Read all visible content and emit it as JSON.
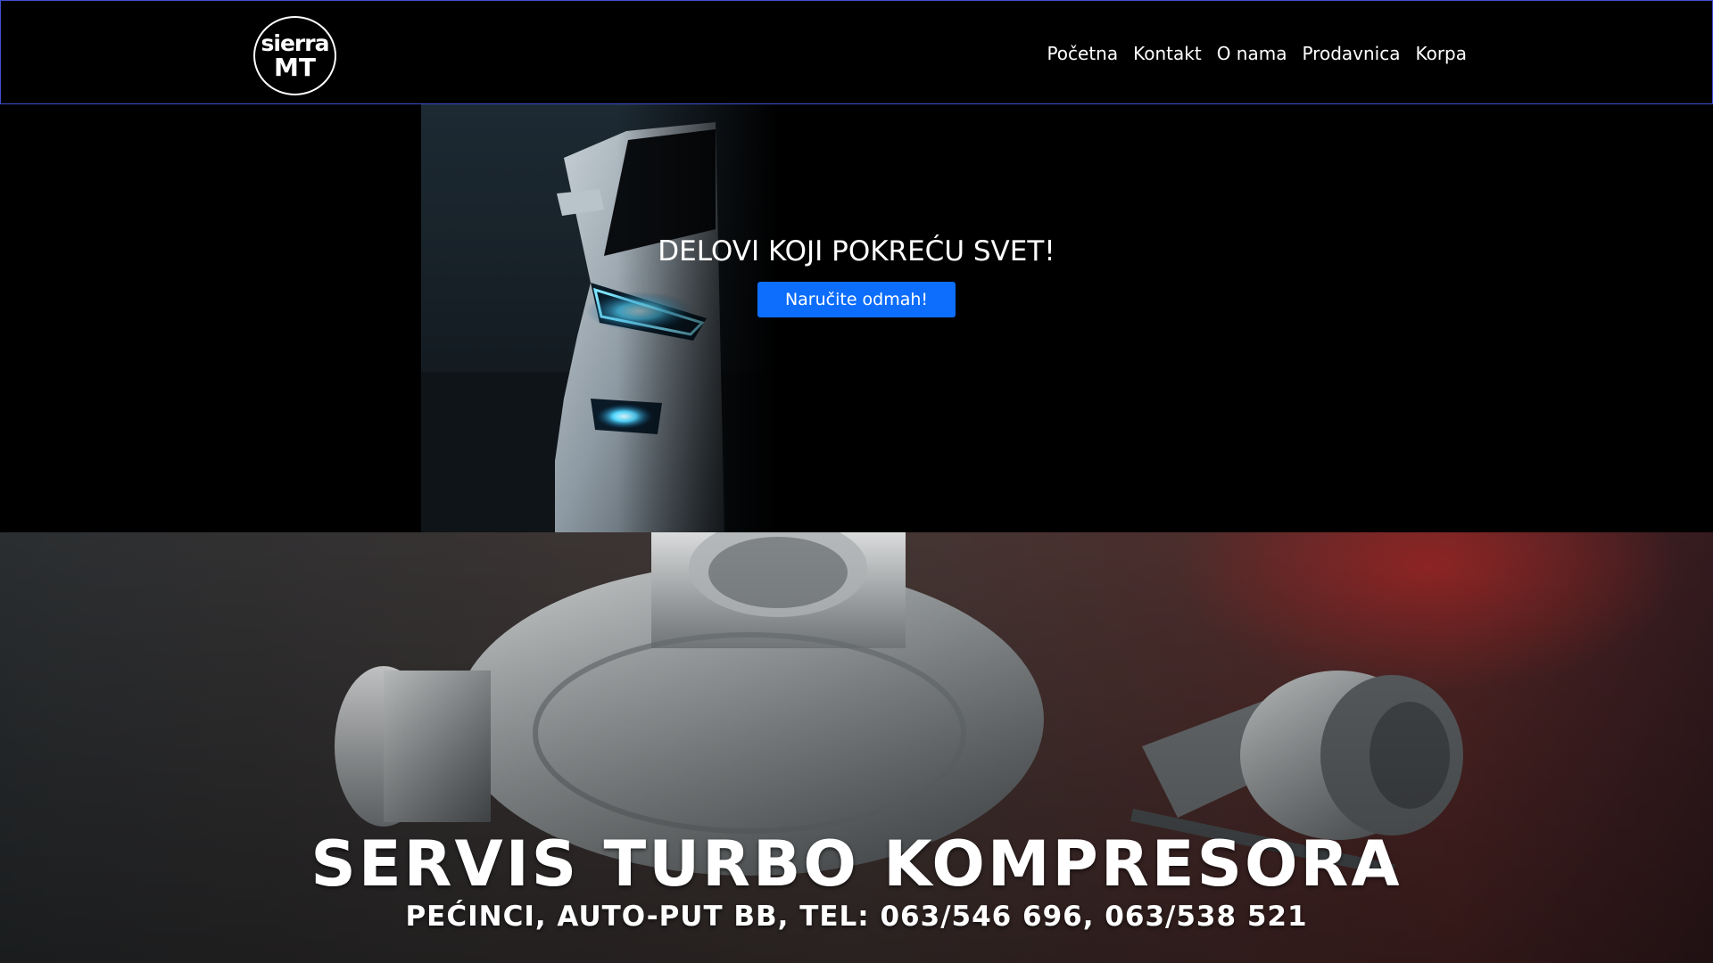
{
  "logo": {
    "line1": "sierra",
    "line2": "MT"
  },
  "nav": {
    "items": [
      {
        "label": "Početna"
      },
      {
        "label": "Kontakt"
      },
      {
        "label": "O nama"
      },
      {
        "label": "Prodavnica"
      },
      {
        "label": "Korpa"
      }
    ]
  },
  "hero": {
    "title": "DELOVI KOJI POKREĆU SVET!",
    "button_label": "Naručite odmah!",
    "image": "car-headlights-image"
  },
  "banner": {
    "title": "SERVIS TURBO KOMPRESORA",
    "subtitle": "PEĆINCI, AUTO-PUT BB, TEL: 063/546 696, 063/538 521",
    "image": "turbo-compressor-image"
  },
  "colors": {
    "background": "#000000",
    "nav_border": "#3f4fd1",
    "button": "#0d6efd",
    "text": "#ffffff"
  }
}
